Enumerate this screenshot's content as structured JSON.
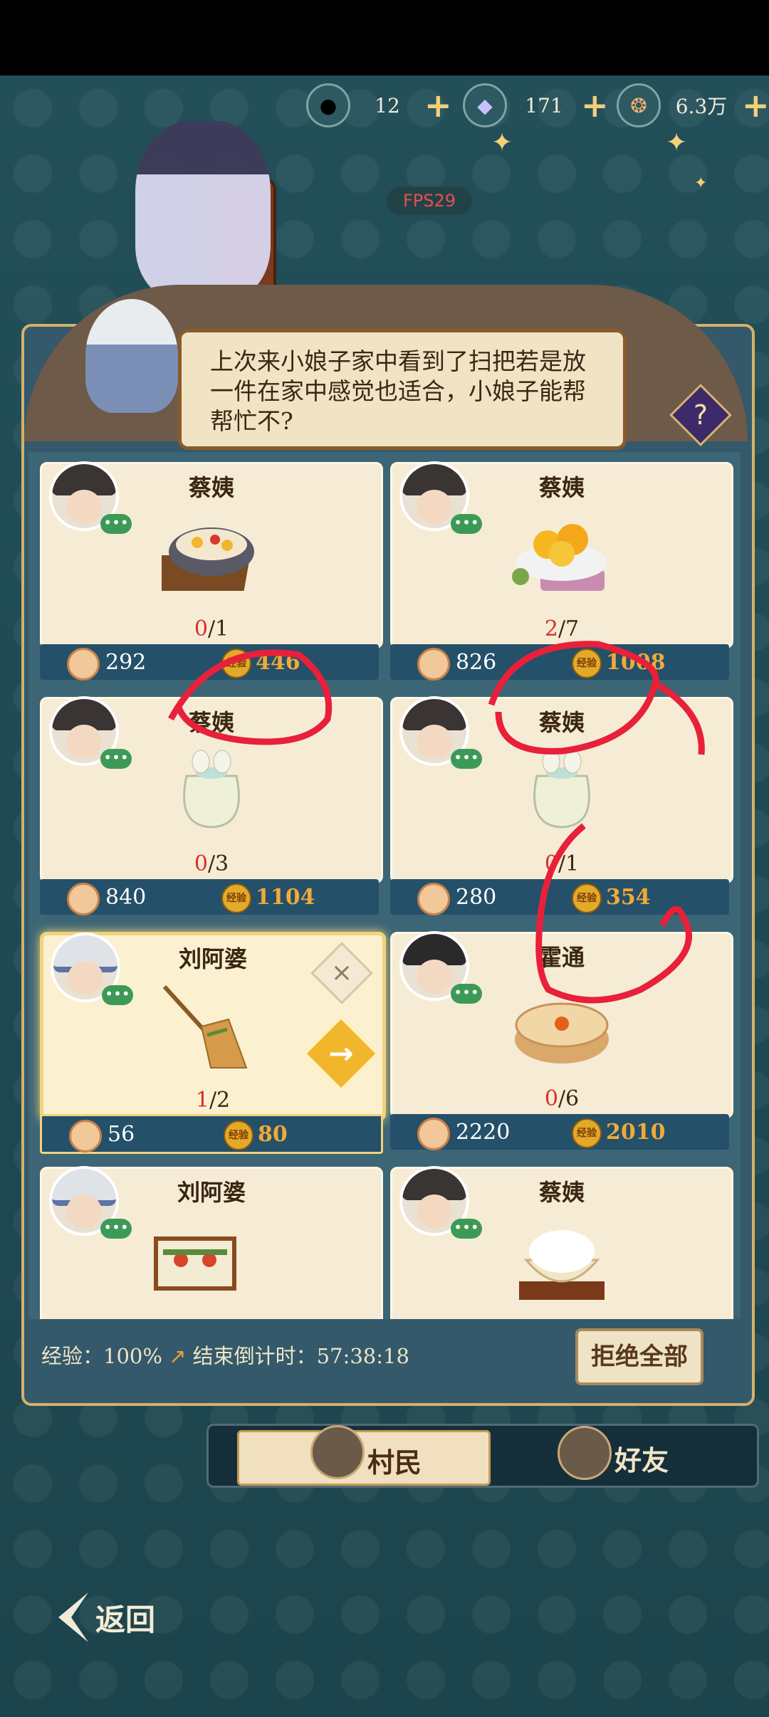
{
  "currencies": [
    {
      "icon": "steamed-bun-icon",
      "value": "12"
    },
    {
      "icon": "crystal-icon",
      "value": "171"
    },
    {
      "icon": "copper-coin-icon",
      "value": "6.3万"
    }
  ],
  "fps_label": "FPS29",
  "dialogue": "上次来小娘子家中看到了扫把若是放一件在家中感觉也适合，小娘子能帮帮忙不?",
  "help_label": "?",
  "cards": [
    {
      "name": "蔡姨",
      "item": "soup-bowl",
      "progress_done": "0",
      "progress_total": "/1",
      "coins": "292",
      "exp": "446"
    },
    {
      "name": "蔡姨",
      "item": "flower-plate",
      "progress_done": "2",
      "progress_total": "/7",
      "coins": "826",
      "exp": "1008"
    },
    {
      "name": "蔡姨",
      "item": "cloth-bag",
      "progress_done": "0",
      "progress_total": "/3",
      "coins": "840",
      "exp": "1104"
    },
    {
      "name": "蔡姨",
      "item": "cloth-bag",
      "progress_done": "0",
      "progress_total": "/1",
      "coins": "280",
      "exp": "354"
    },
    {
      "name": "刘阿婆",
      "item": "broom",
      "progress_done": "1",
      "progress_total": "/2",
      "coins": "56",
      "exp": "80"
    },
    {
      "name": "霍通",
      "item": "round-cake",
      "progress_done": "0",
      "progress_total": "/6",
      "coins": "2220",
      "exp": "2010"
    },
    {
      "name": "刘阿婆",
      "item": "wooden-chair"
    },
    {
      "name": "蔡姨",
      "item": "rice-bowl"
    }
  ],
  "exp_badge_text": "经验",
  "close_label": "×",
  "go_label": "→",
  "chat_badge": "•••",
  "footer": {
    "exp_label": "经验：100%",
    "countdown_label": "结束倒计时：57:38:18",
    "reject_all": "拒绝全部"
  },
  "tabs": [
    {
      "label": "村民",
      "active": true
    },
    {
      "label": "好友",
      "active": false
    }
  ],
  "back_label": "返回",
  "colors": {
    "accent": "#f3d27a",
    "annotation": "#e8203a"
  }
}
